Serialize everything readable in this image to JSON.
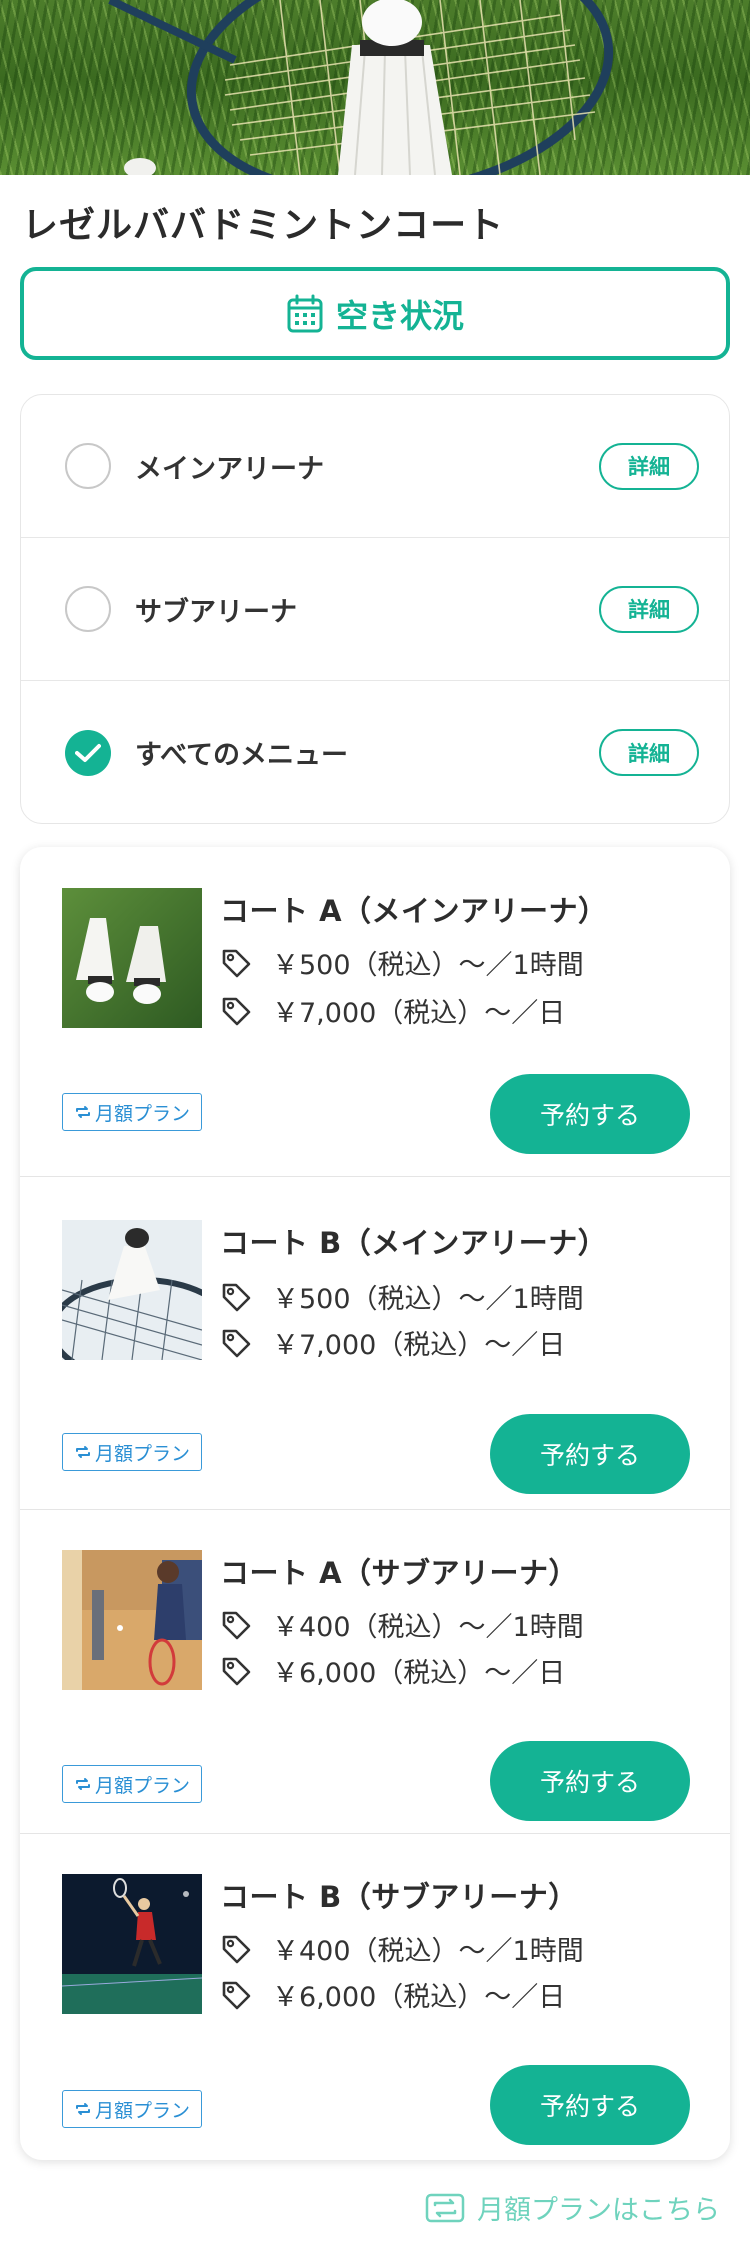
{
  "facility": {
    "title": "レゼルババドミントンコート"
  },
  "availability_button": {
    "label": "空き状況",
    "icon": "calendar-icon"
  },
  "categories": [
    {
      "label": "メインアリーナ",
      "checked": false,
      "detail_label": "詳細"
    },
    {
      "label": "サブアリーナ",
      "checked": false,
      "detail_label": "詳細"
    },
    {
      "label": "すべてのメニュー",
      "checked": true,
      "detail_label": "詳細"
    }
  ],
  "courts": [
    {
      "name": "コート A（メインアリーナ）",
      "price_hour": "￥500（税込）～／1時間",
      "price_day": "￥7,000（税込）～／日",
      "badge": "月額プラン",
      "reserve_label": "予約する",
      "thumb": "shuttlecocks-on-grass"
    },
    {
      "name": "コート B（メインアリーナ）",
      "price_hour": "￥500（税込）～／1時間",
      "price_day": "￥7,000（税込）～／日",
      "badge": "月額プラン",
      "reserve_label": "予約する",
      "thumb": "shuttlecock-on-racket"
    },
    {
      "name": "コート A（サブアリーナ）",
      "price_hour": "￥400（税込）～／1時間",
      "price_day": "￥6,000（税込）～／日",
      "badge": "月額プラン",
      "reserve_label": "予約する",
      "thumb": "player-indoor-gym"
    },
    {
      "name": "コート B（サブアリーナ）",
      "price_hour": "￥400（税込）～／1時間",
      "price_day": "￥6,000（税込）～／日",
      "badge": "月額プラン",
      "reserve_label": "予約する",
      "thumb": "player-jump-smash"
    }
  ],
  "footer": {
    "monthly_link": "月額プランはこちら"
  },
  "colors": {
    "accent": "#14b394",
    "badge_blue": "#2a8fd4",
    "footer_link": "#6fd3bd"
  }
}
